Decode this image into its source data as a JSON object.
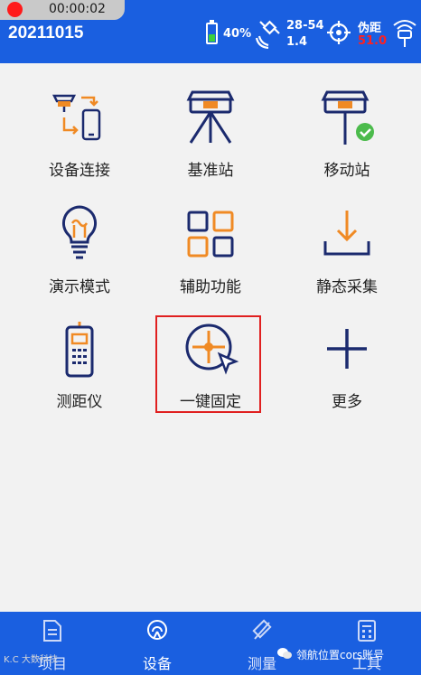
{
  "status": {
    "rec_time": "00:00:02",
    "project": "20211015",
    "battery": "40%",
    "battery_level": 0.4,
    "satellites": "28-54",
    "pdop": "1.4",
    "fix_label": "伪距",
    "fix_age": "51.0"
  },
  "grid": [
    {
      "label": "设备连接",
      "icon": "device-connect-icon"
    },
    {
      "label": "基准站",
      "icon": "base-station-icon"
    },
    {
      "label": "移动站",
      "icon": "rover-station-icon"
    },
    {
      "label": "演示模式",
      "icon": "lightbulb-icon"
    },
    {
      "label": "辅助功能",
      "icon": "grid-tools-icon"
    },
    {
      "label": "静态采集",
      "icon": "download-icon"
    },
    {
      "label": "测距仪",
      "icon": "rangefinder-icon"
    },
    {
      "label": "一键固定",
      "icon": "target-fix-icon"
    },
    {
      "label": "更多",
      "icon": "plus-icon"
    }
  ],
  "tabs": [
    {
      "label": "项目",
      "icon": "document-icon"
    },
    {
      "label": "设备",
      "icon": "antenna-icon"
    },
    {
      "label": "测量",
      "icon": "survey-icon"
    },
    {
      "label": "工具",
      "icon": "calculator-icon"
    }
  ],
  "watermark": {
    "left": "K.C 大数科技",
    "right": "领航位置cors账号"
  },
  "colors": {
    "brand_blue": "#1a5fe0",
    "icon_navy": "#1b2a6e",
    "icon_orange": "#f08a24",
    "highlight_red": "#e02020"
  }
}
